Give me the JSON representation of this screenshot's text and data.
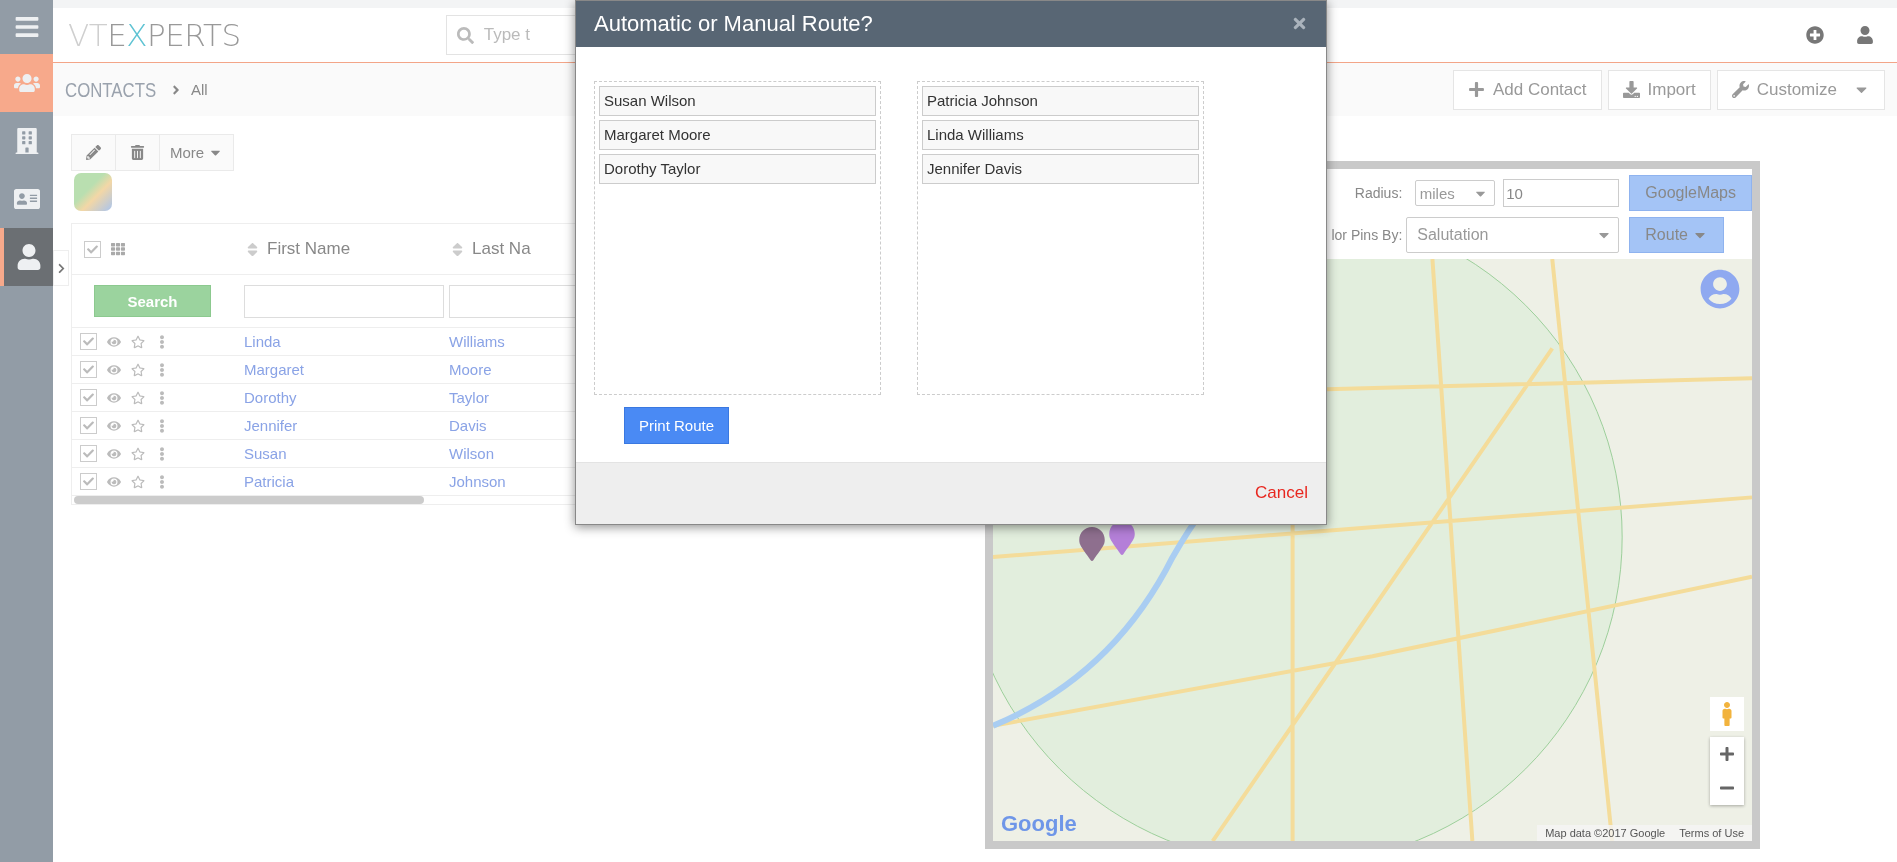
{
  "sidebar": {
    "items": [
      {
        "kind": "menu",
        "active": false,
        "selected": false
      },
      {
        "kind": "contacts",
        "active": true,
        "selected": false
      },
      {
        "kind": "organizations",
        "active": false,
        "selected": false
      },
      {
        "kind": "card",
        "active": false,
        "selected": false
      },
      {
        "kind": "person",
        "active": false,
        "selected": true
      }
    ]
  },
  "header": {
    "logo": [
      "VT",
      "E",
      "X",
      "PERTS"
    ],
    "search": {
      "placeholder": "Type t"
    }
  },
  "breadcrumb": {
    "module": "CONTACTS",
    "view": "All"
  },
  "actions": [
    {
      "kind": "add",
      "label": "Add Contact",
      "dropdown": false
    },
    {
      "kind": "import",
      "label": "Import",
      "dropdown": false
    },
    {
      "kind": "customize",
      "label": "Customize",
      "dropdown": true
    }
  ],
  "toolbar": {
    "more": "More"
  },
  "table": {
    "header_checked": true,
    "columns": [
      "First Name",
      "Last Na"
    ],
    "search_button": "Search",
    "rows": [
      {
        "checked": true,
        "first": "Linda",
        "last": "Williams"
      },
      {
        "checked": true,
        "first": "Margaret",
        "last": "Moore"
      },
      {
        "checked": true,
        "first": "Dorothy",
        "last": "Taylor"
      },
      {
        "checked": true,
        "first": "Jennifer",
        "last": "Davis"
      },
      {
        "checked": true,
        "first": "Susan",
        "last": "Wilson"
      },
      {
        "checked": true,
        "first": "Patricia",
        "last": "Johnson"
      }
    ]
  },
  "map_panel": {
    "radius_label": "Radius:",
    "unit": "miles",
    "radius": "10",
    "googlemaps_button": "GoogleMaps",
    "pins_label": "lor Pins By:",
    "pins_value": "Salutation",
    "route_button": "Route",
    "logo": "Google",
    "attribution": [
      "Map data ©2017 Google",
      "Terms of Use"
    ]
  },
  "modal": {
    "title": "Automatic or Manual Route?",
    "lists": [
      [
        "Susan Wilson",
        "Margaret Moore",
        "Dorothy Taylor"
      ],
      [
        "Patricia Johnson",
        "Linda Williams",
        "Jennifer Davis"
      ]
    ],
    "print_button": "Print Route",
    "cancel": "Cancel"
  }
}
